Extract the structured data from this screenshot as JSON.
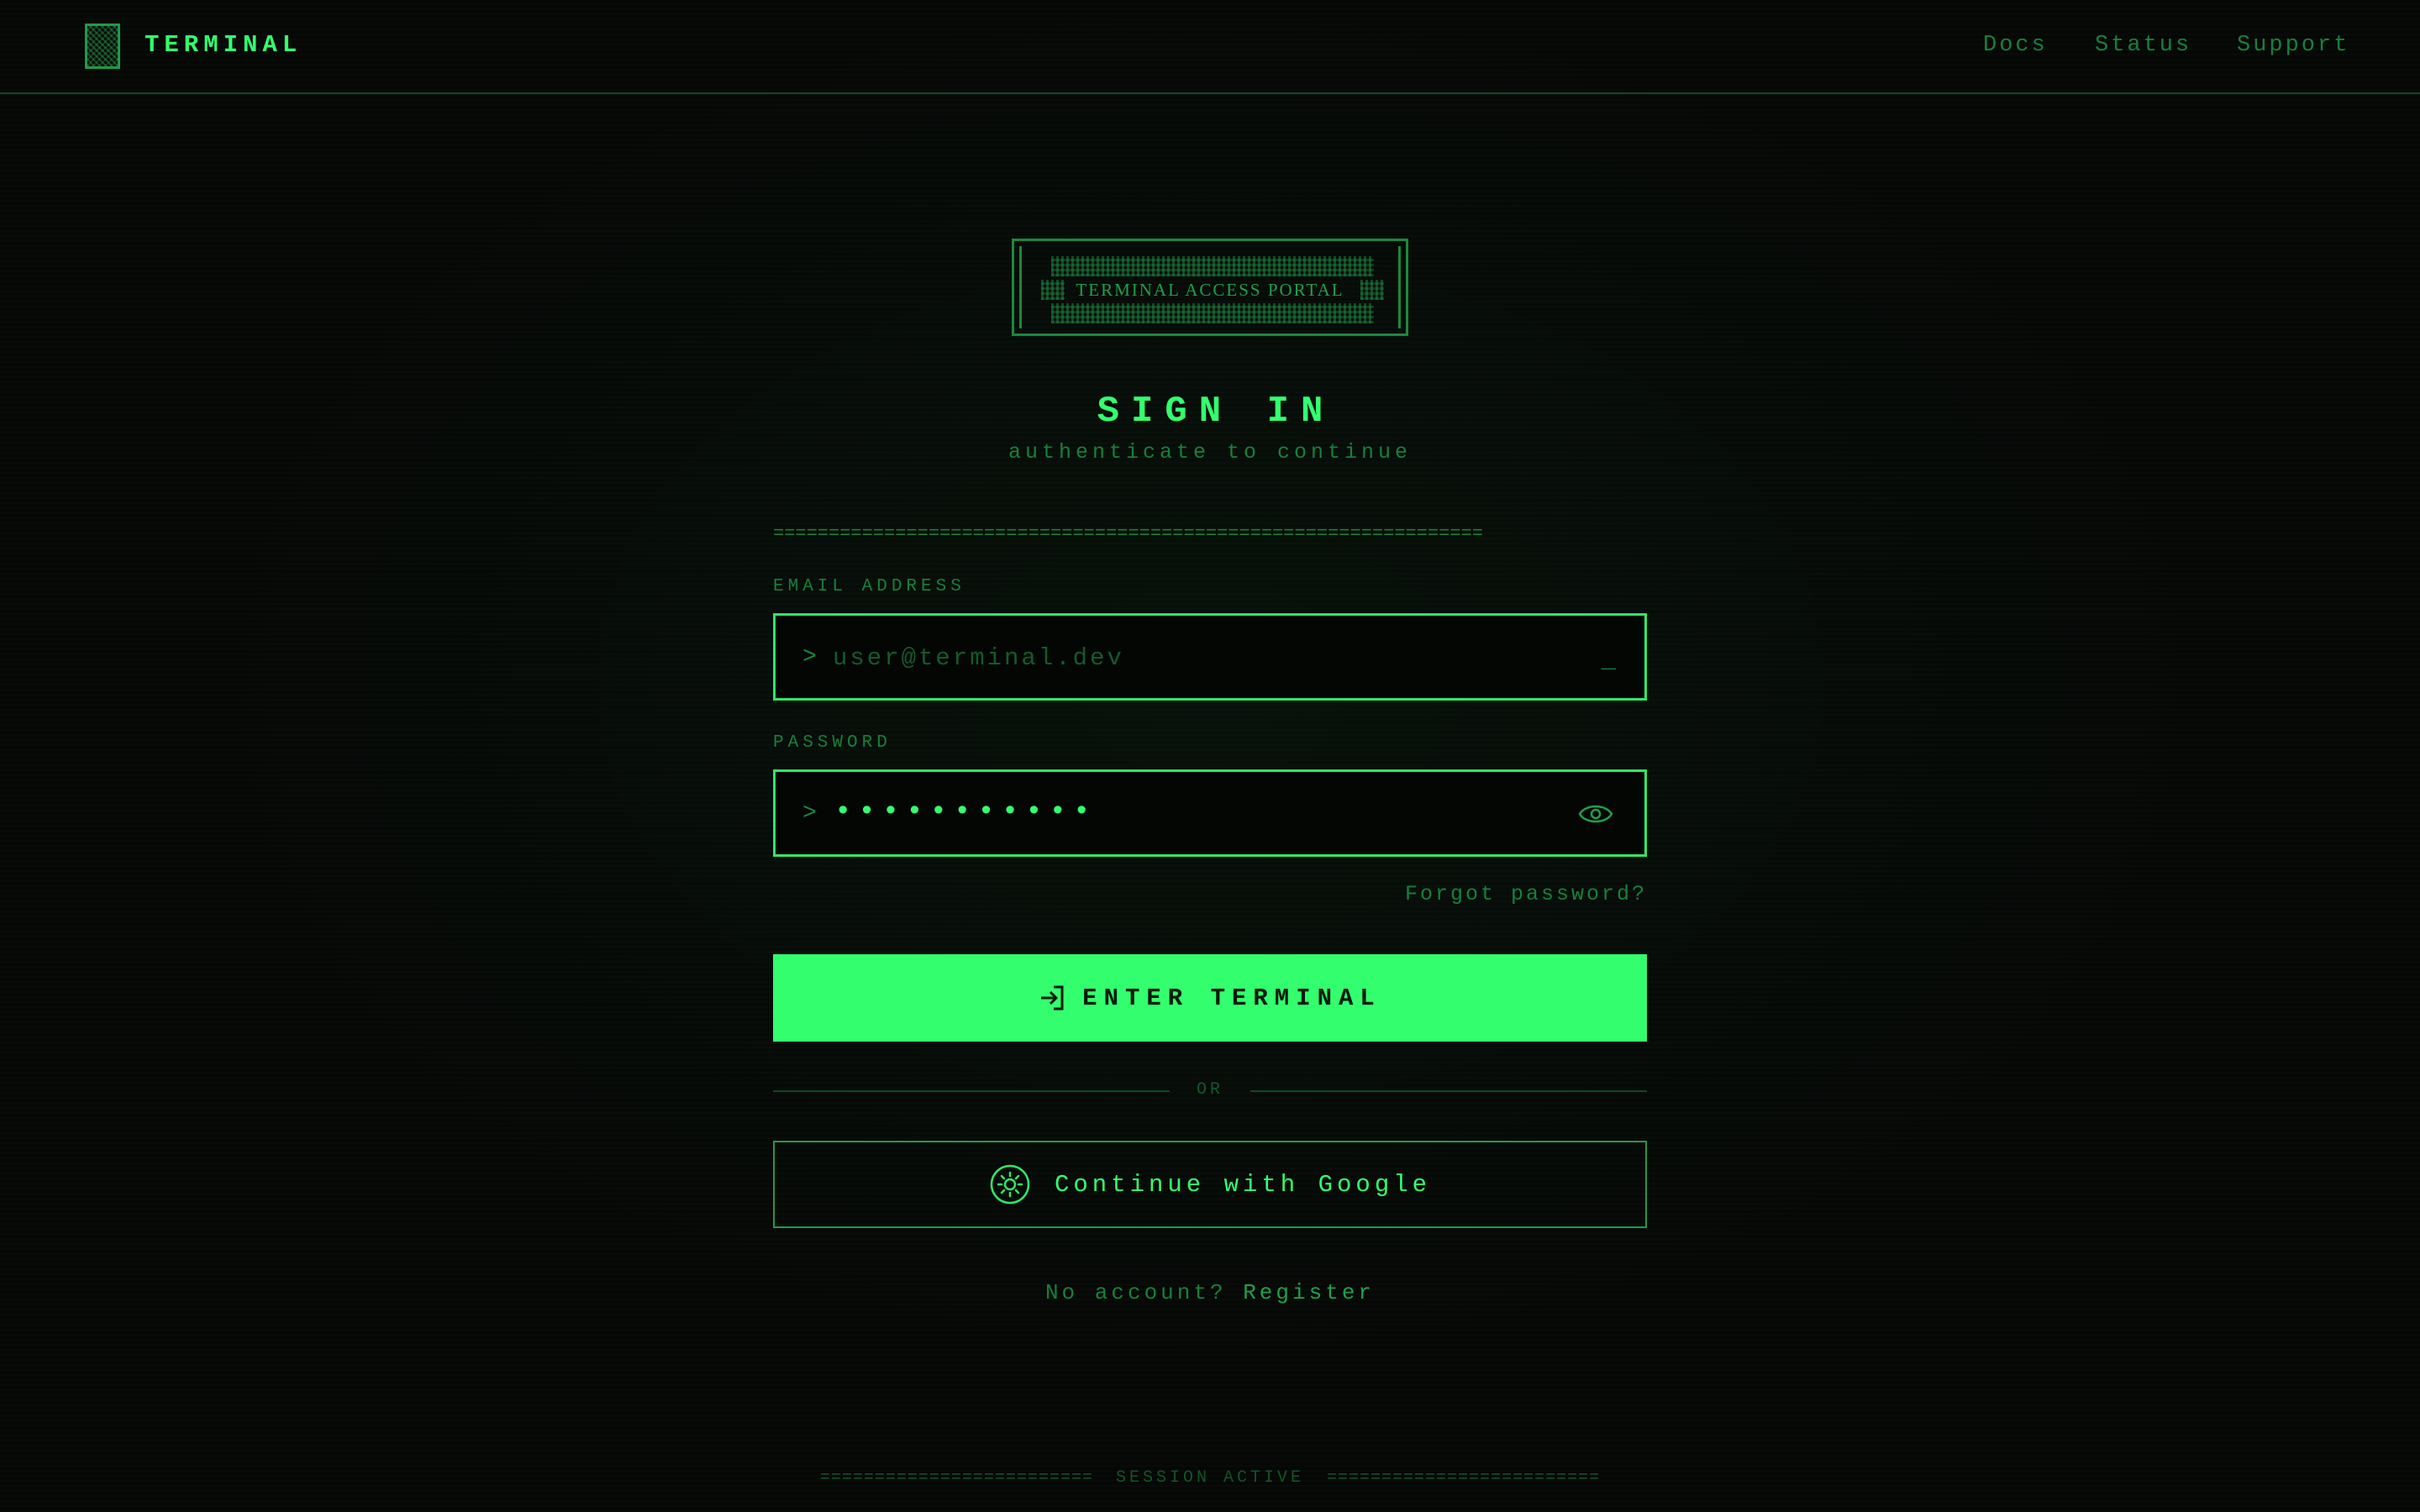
{
  "header": {
    "logo_icon": "terminal-logo-block",
    "brand": "TERMINAL",
    "nav": [
      {
        "label": "Docs"
      },
      {
        "label": "Status"
      },
      {
        "label": "Support"
      }
    ]
  },
  "banner": {
    "text": "TERMINAL ACCESS PORTAL"
  },
  "main": {
    "title": "SIGN IN",
    "subtitle": "authenticate to continue",
    "rule": "================================================================"
  },
  "form": {
    "email": {
      "label": "EMAIL ADDRESS",
      "prompt": ">",
      "placeholder": "user@terminal.dev",
      "value": "",
      "cursor": "_"
    },
    "password": {
      "label": "PASSWORD",
      "prompt": ">",
      "masked_value": "•••••••••••",
      "toggle_icon": "eye-icon"
    },
    "forgot_label": "Forgot password?",
    "submit_label": "ENTER TERMINAL",
    "submit_icon": "login-arrow-icon",
    "divider_label": "OR",
    "google_label": "Continue with Google",
    "google_icon": "sun-gear-icon",
    "register_question": "No account?",
    "register_link": "Register"
  },
  "footer": {
    "status": "SESSION ACTIVE",
    "rule": "========================="
  },
  "colors": {
    "background": "#060806",
    "accent": "#33ff6e",
    "muted": "#17803a",
    "dim": "#145a2b"
  }
}
